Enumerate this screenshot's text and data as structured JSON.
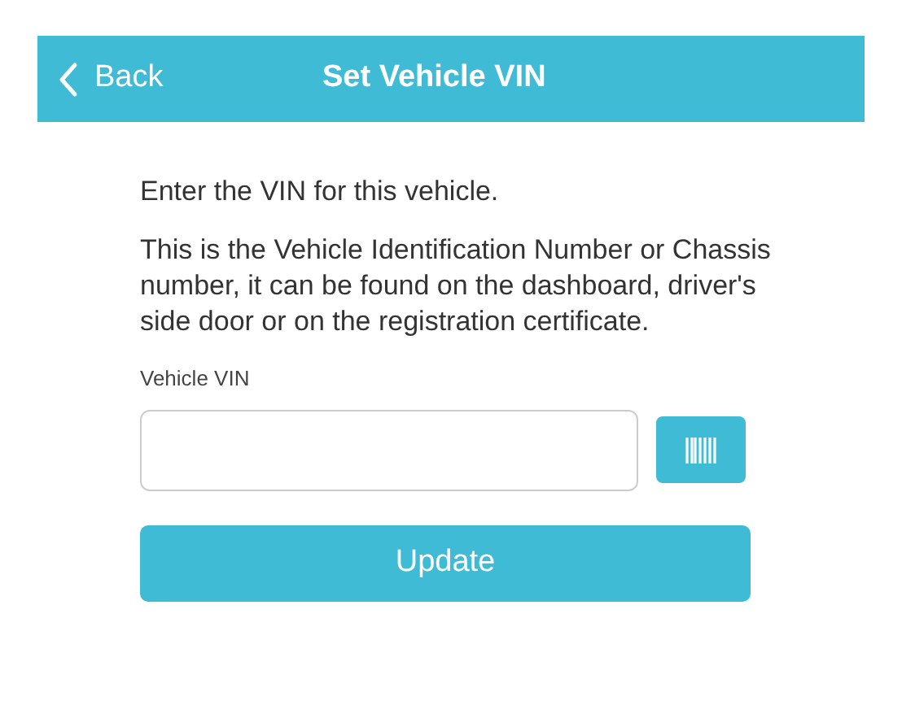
{
  "header": {
    "back": "Back",
    "title": "Set Vehicle VIN"
  },
  "intro": "Enter the VIN for this vehicle.",
  "description": "This is the Vehicle Identification Number or Chassis number, it can be found on the dashboard, driver's side door or on the registration certificate.",
  "field": {
    "label": "Vehicle VIN"
  },
  "button": "Update"
}
